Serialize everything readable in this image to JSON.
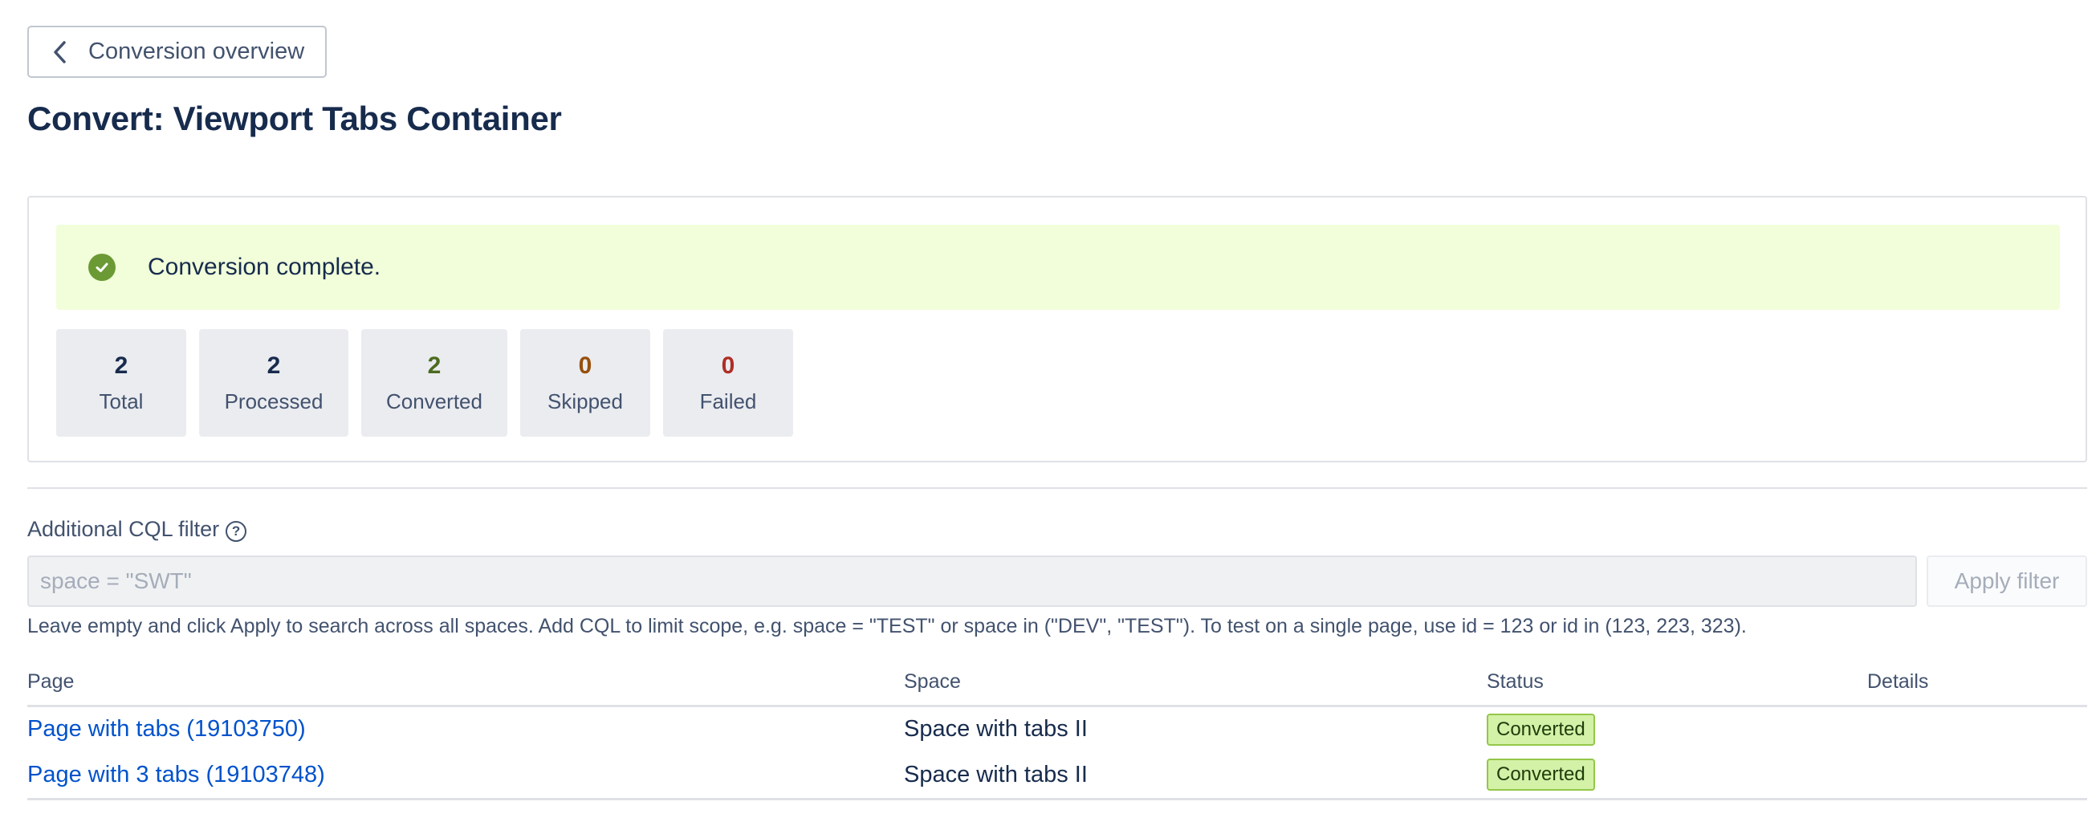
{
  "back_button": {
    "label": "Conversion overview",
    "icon": "chevron-left-icon"
  },
  "title": "Convert: Viewport Tabs Container",
  "banner": {
    "message": "Conversion complete.",
    "icon": "check-circle-icon",
    "color": "#6b9a34",
    "background": "#f1fed9"
  },
  "stats": {
    "total": {
      "value": "2",
      "label": "Total",
      "color": "#172b4d"
    },
    "processed": {
      "value": "2",
      "label": "Processed",
      "color": "#172b4d"
    },
    "converted": {
      "value": "2",
      "label": "Converted",
      "color": "#4c6b1f"
    },
    "skipped": {
      "value": "0",
      "label": "Skipped",
      "color": "#974f0c"
    },
    "failed": {
      "value": "0",
      "label": "Failed",
      "color": "#ae2e24"
    }
  },
  "filter": {
    "label": "Additional CQL filter",
    "help_icon": "question-circle-icon",
    "value": "",
    "placeholder": "space = \"SWT\"",
    "apply_label": "Apply filter",
    "help_text": "Leave empty and click Apply to search across all spaces. Add CQL to limit scope, e.g. space = \"TEST\" or space in (\"DEV\", \"TEST\"). To test on a single page, use id = 123 or id in (123, 223, 323)."
  },
  "table": {
    "headers": {
      "page": "Page",
      "space": "Space",
      "status": "Status",
      "details": "Details"
    },
    "rows": [
      {
        "page": "Page with tabs (19103750)",
        "space": "Space with tabs II",
        "status": "Converted",
        "details": ""
      },
      {
        "page": "Page with 3 tabs (19103748)",
        "space": "Space with tabs II",
        "status": "Converted",
        "details": ""
      }
    ]
  }
}
